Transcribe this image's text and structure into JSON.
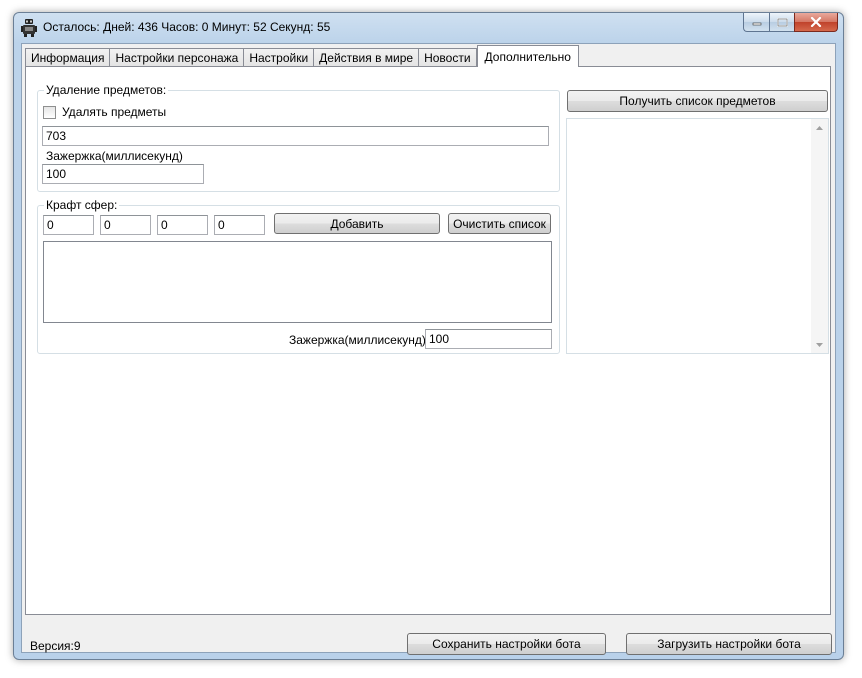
{
  "window": {
    "title": "Осталось: Дней: 436 Часов: 0 Минут: 52 Секунд: 55"
  },
  "tabs": [
    {
      "label": "Информация",
      "active": false
    },
    {
      "label": "Настройки персонажа",
      "active": false
    },
    {
      "label": "Настройки",
      "active": false
    },
    {
      "label": "Действия в мире",
      "active": false
    },
    {
      "label": "Новости",
      "active": false
    },
    {
      "label": "Дополнительно",
      "active": true
    }
  ],
  "delete_items": {
    "group_title": "Удаление предметов:",
    "checkbox_label": "Удалять предметы",
    "checked": false,
    "items_value": "703",
    "delay_label": "Зажержка(миллисекунд)",
    "delay_value": "100"
  },
  "craft": {
    "group_title": "Крафт сфер:",
    "fields": [
      "0",
      "0",
      "0",
      "0"
    ],
    "add_label": "Добавить",
    "clear_label": "Очистить список",
    "delay_label": "Зажержка(миллисекунд)",
    "delay_value": "100"
  },
  "items_list": {
    "get_button_label": "Получить список предметов"
  },
  "footer": {
    "version": "Версия:9",
    "save_label": "Сохранить настройки бота",
    "load_label": "Загрузить настройки бота"
  },
  "icons": {
    "app": "robot-icon",
    "minimize": "minimize-icon",
    "maximize": "maximize-icon",
    "close": "close-icon"
  },
  "colors": {
    "window_frame": "#b9d1ea",
    "close_button": "#c0422b",
    "tab_page": "#ffffff"
  }
}
